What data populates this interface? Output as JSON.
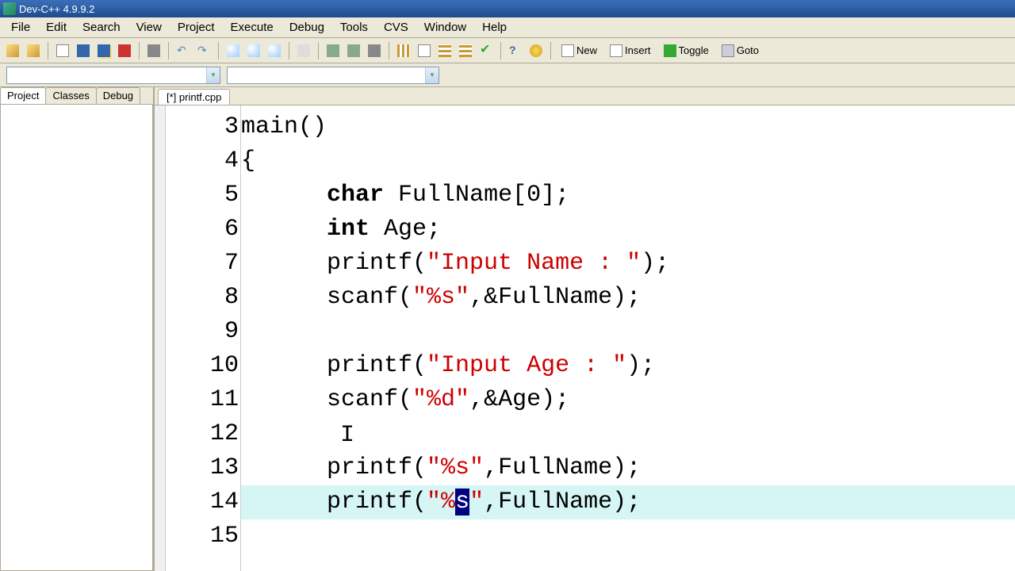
{
  "title": "Dev-C++ 4.9.9.2",
  "menu": {
    "file": "File",
    "edit": "Edit",
    "search": "Search",
    "view": "View",
    "project": "Project",
    "execute": "Execute",
    "debug": "Debug",
    "tools": "Tools",
    "cvs": "CVS",
    "window": "Window",
    "help": "Help"
  },
  "toolbar": {
    "new": "New",
    "insert": "Insert",
    "toggle": "Toggle",
    "goto": "Goto"
  },
  "side_tabs": {
    "project": "Project",
    "classes": "Classes",
    "debug": "Debug"
  },
  "file_tab": "[*] printf.cpp",
  "code": {
    "lines": [
      {
        "num": "3",
        "type": "plain",
        "text": "main()"
      },
      {
        "num": "4",
        "type": "plain",
        "text": "{"
      },
      {
        "num": "5",
        "type": "decl_char",
        "kw": "char",
        "rest": " FullName[0];"
      },
      {
        "num": "6",
        "type": "decl_int",
        "kw": "int",
        "rest": " Age;"
      },
      {
        "num": "7",
        "type": "call_str",
        "pre": "printf(",
        "str": "\"Input Name : \"",
        "post": ");"
      },
      {
        "num": "8",
        "type": "call_str",
        "pre": "scanf(",
        "str": "\"%s\"",
        "post": ",&FullName);"
      },
      {
        "num": "9",
        "type": "blank"
      },
      {
        "num": "10",
        "type": "call_str",
        "pre": "printf(",
        "str": "\"Input Age : \"",
        "post": ");"
      },
      {
        "num": "11",
        "type": "call_str",
        "pre": "scanf(",
        "str": "\"%d\"",
        "post": ",&Age);"
      },
      {
        "num": "12",
        "type": "cursor"
      },
      {
        "num": "13",
        "type": "call_str",
        "pre": "printf(",
        "str": "\"%s\"",
        "post": ",FullName);"
      },
      {
        "num": "14",
        "type": "call_sel",
        "pre": "printf(",
        "str_pre": "\"%",
        "sel": "s",
        "str_post": "\"",
        "post": ",FullName);",
        "hl": true
      },
      {
        "num": "15",
        "type": "blank"
      }
    ],
    "indent_main": "",
    "indent_body": "      "
  }
}
